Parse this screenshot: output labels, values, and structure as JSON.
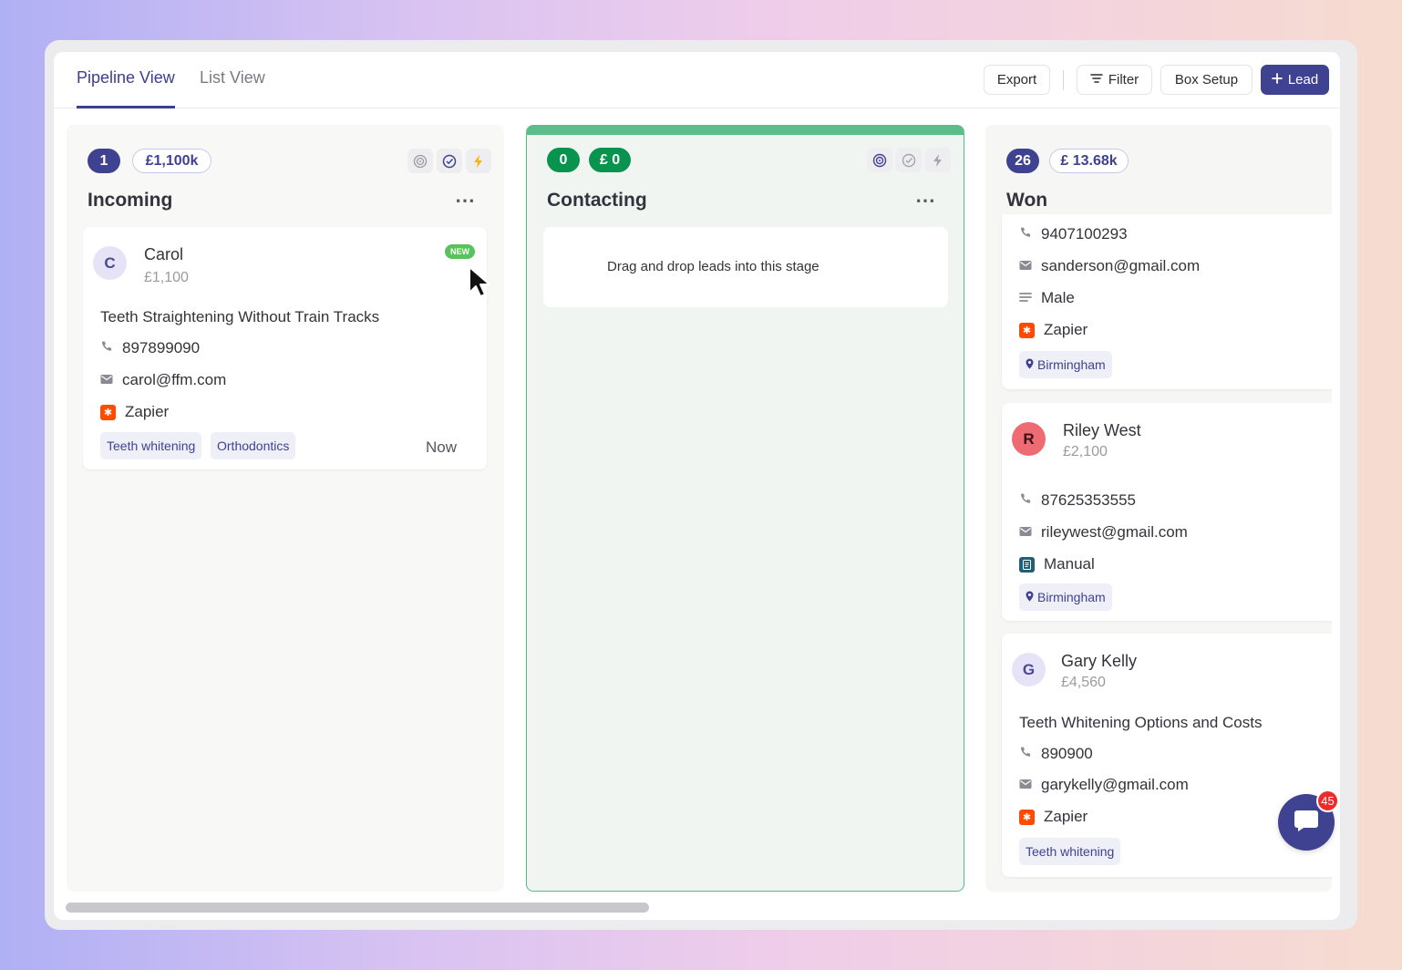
{
  "tabs": {
    "pipeline": "Pipeline View",
    "list": "List View"
  },
  "header": {
    "export": "Export",
    "filter": "Filter",
    "box_setup": "Box Setup",
    "lead": "Lead"
  },
  "columns": {
    "incoming": {
      "count": "1",
      "value": "£1,100k",
      "title": "Incoming",
      "card": {
        "initial": "C",
        "name": "Carol",
        "amount": "£1,100",
        "badge": "NEW",
        "subject": "Teeth Straightening Without Train Tracks",
        "phone": "897899090",
        "email": "carol@ffm.com",
        "source": "Zapier",
        "tags": [
          "Teeth whitening",
          "Orthodontics"
        ],
        "time": "Now"
      }
    },
    "contacting": {
      "count": "0",
      "value": "£ 0",
      "title": "Contacting",
      "empty_text": "Drag and drop leads into this stage"
    },
    "won": {
      "count": "26",
      "value": "£ 13.68k",
      "title": "Won",
      "cards": [
        {
          "phone": "9407100293",
          "email": "sanderson@gmail.com",
          "gender": "Male",
          "source": "Zapier",
          "location": "Birmingham"
        },
        {
          "initial": "R",
          "name": "Riley West",
          "amount": "£2,100",
          "phone": "87625353555",
          "email": "rileywest@gmail.com",
          "source": "Manual",
          "location": "Birmingham"
        },
        {
          "initial": "G",
          "name": "Gary Kelly",
          "amount": "£4,560",
          "subject": "Teeth Whitening Options and Costs",
          "phone": "890900",
          "email": "garykelly@gmail.com",
          "source": "Zapier",
          "tag": "Teeth whitening"
        }
      ]
    }
  },
  "chat": {
    "badge": "45"
  },
  "colors": {
    "primary": "#3f4291",
    "green": "#08934e",
    "accent_green_border": "#5dbd8a",
    "zapier": "#ff4a00",
    "badge_red": "#ee2a2a"
  },
  "icons": [
    "filter-icon",
    "plus-icon",
    "target-icon",
    "check-circle-icon",
    "bolt-icon",
    "more-icon",
    "phone-icon",
    "mail-icon",
    "gender-icon",
    "zapier-icon",
    "manual-icon",
    "location-pin-icon",
    "chat-icon",
    "cursor-icon"
  ]
}
